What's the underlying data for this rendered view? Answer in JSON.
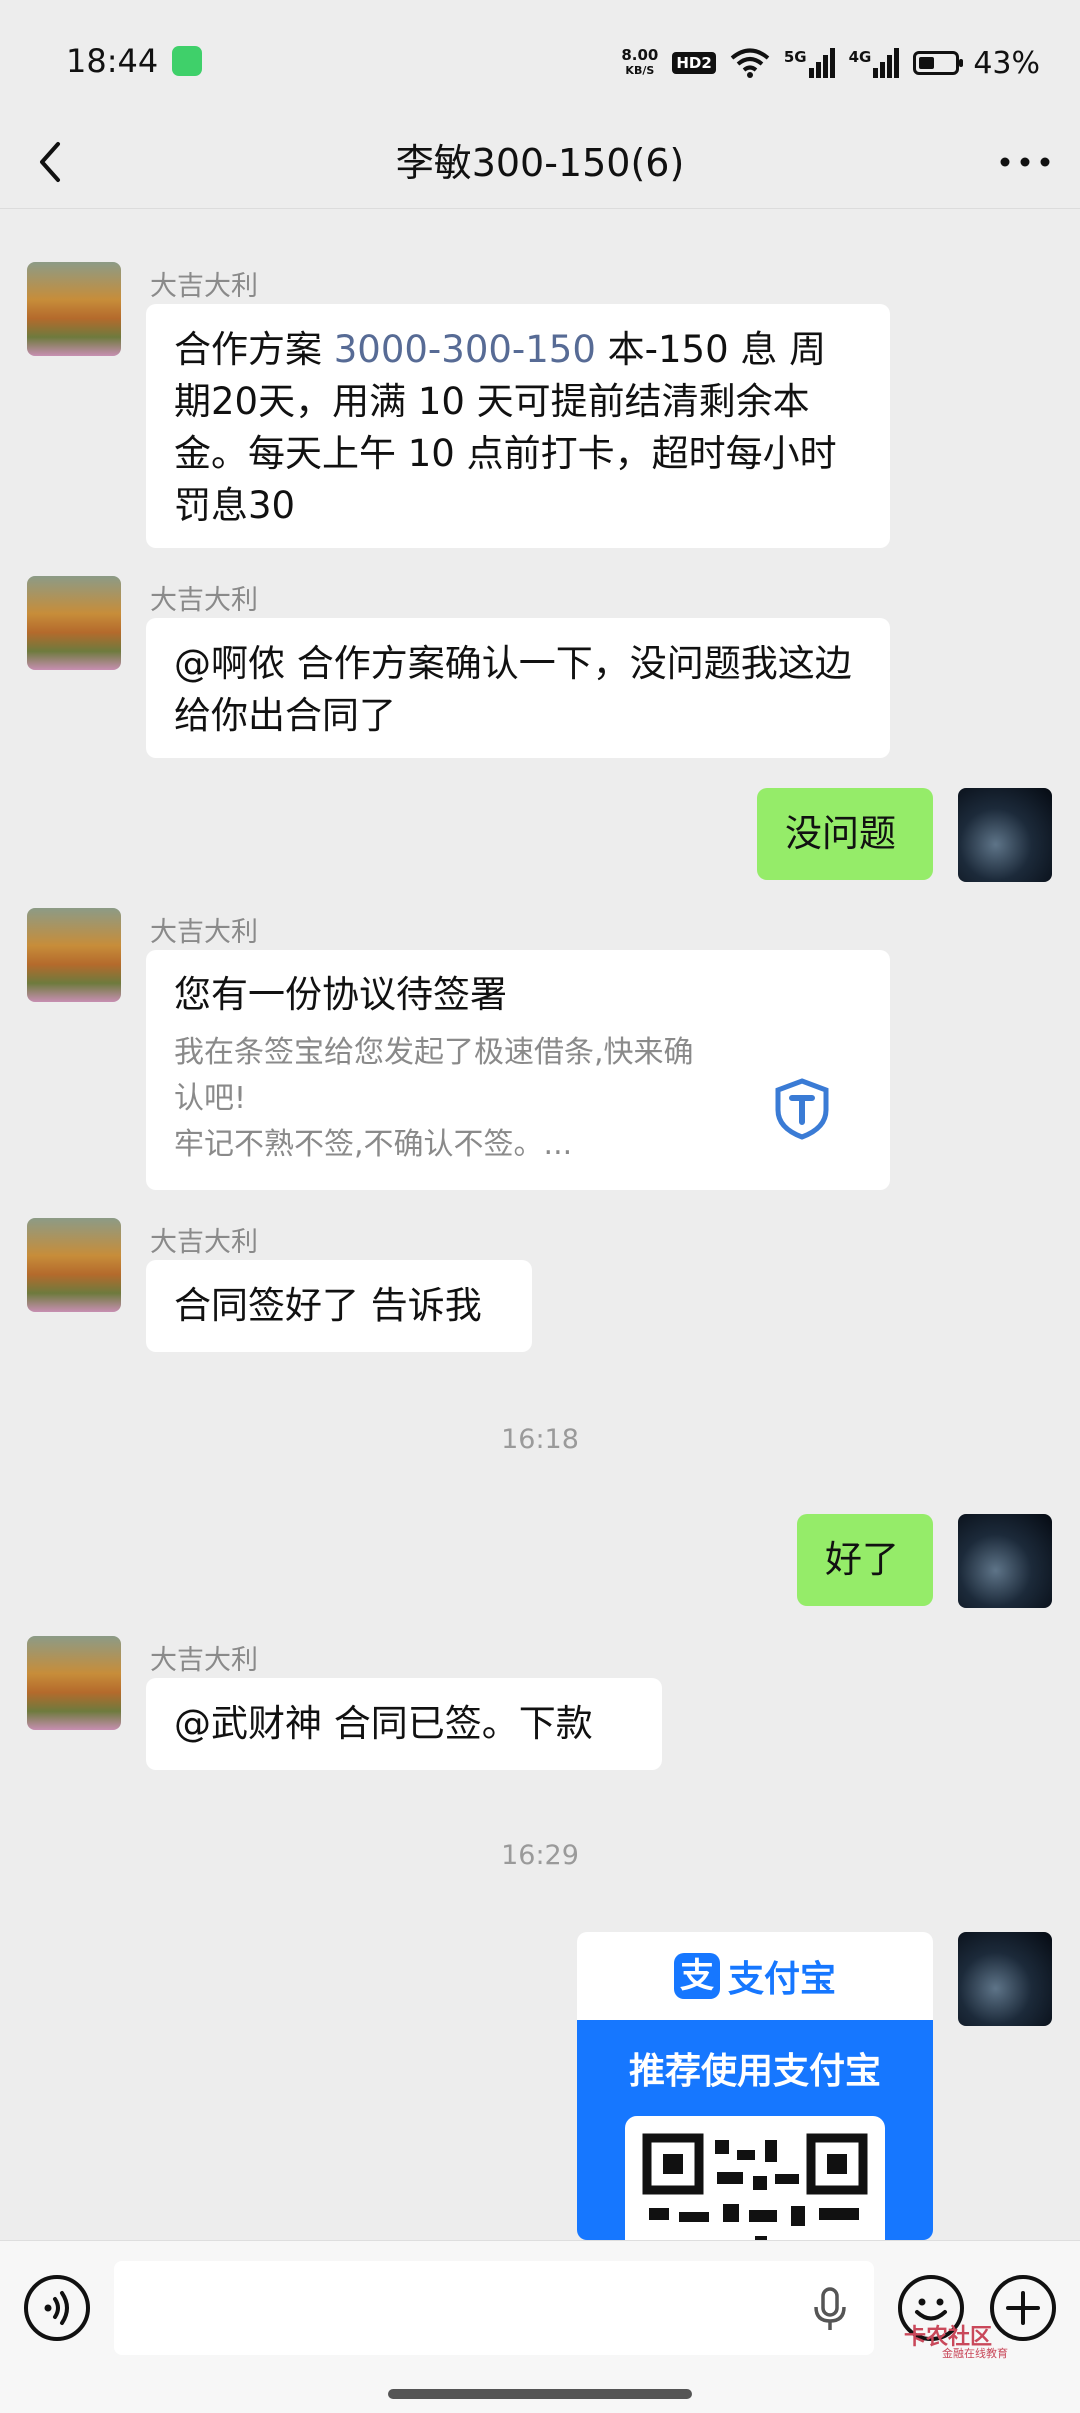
{
  "status_bar": {
    "time": "18:44",
    "net_speed_value": "8.00",
    "net_speed_unit": "KB/S",
    "hd_badge": "HD2",
    "signal1_label": "5G",
    "signal2_label": "4G",
    "battery_level": 0.43,
    "battery_text": "43%"
  },
  "header": {
    "title": "李敏300-150(6)",
    "back_icon": "chevron-left-icon",
    "more_icon": "more-dots-icon"
  },
  "messages": [
    {
      "sender": "大吉大利",
      "side": "left",
      "text_before": "合作方案 ",
      "text_link": "3000-300-150",
      "text_after": " 本-150 息 周期20天，用满 10 天可提前结清剩余本金。每天上午 10 点前打卡，超时每小时罚息30"
    },
    {
      "sender": "大吉大利",
      "side": "left",
      "text": "@啊侬  合作方案确认一下，没问题我这边给你出合同了"
    },
    {
      "side": "right",
      "text": "没问题"
    },
    {
      "sender": "大吉大利",
      "side": "left",
      "card_title": "您有一份协议待签署",
      "card_desc": "我在条签宝给您发起了极速借条,快来确认吧!\n牢记不熟不签,不确认不签。...",
      "card_icon": "shield-logo-icon"
    },
    {
      "sender": "大吉大利",
      "side": "left",
      "text": "合同签好了 告诉我"
    },
    {
      "timestamp": "16:18"
    },
    {
      "side": "right",
      "text": "好了"
    },
    {
      "sender": "大吉大利",
      "side": "left",
      "text": "@武财神  合同已签。下款"
    },
    {
      "timestamp": "16:29"
    },
    {
      "side": "right",
      "alipay_brand": "支付宝",
      "alipay_logo_char": "支",
      "alipay_recommend": "推荐使用支付宝"
    }
  ],
  "input_bar": {
    "voice_icon": "voice-icon",
    "mic_icon": "mic-icon",
    "emoji_icon": "emoji-icon",
    "plus_icon": "plus-icon",
    "watermark": "卡农社区",
    "watermark_sub": "金融在线教育"
  },
  "colors": {
    "background": "#ededed",
    "bubble_me": "#95ec69",
    "bubble_them": "#ffffff",
    "link": "#576b95",
    "alipay_blue": "#1677ff"
  }
}
